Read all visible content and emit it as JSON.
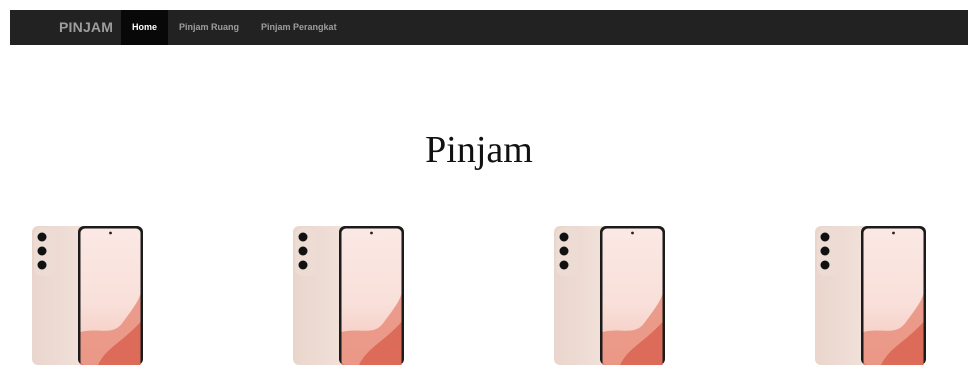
{
  "navbar": {
    "brand": "PINJAM",
    "links": [
      {
        "label": "Home",
        "active": true
      },
      {
        "label": "Pinjam Ruang",
        "active": false
      },
      {
        "label": "Pinjam Perangkat",
        "active": false
      }
    ]
  },
  "main": {
    "title": "Pinjam",
    "products": [
      {
        "image": "phone-image"
      },
      {
        "image": "phone-image"
      },
      {
        "image": "phone-image"
      },
      {
        "image": "phone-image"
      }
    ]
  },
  "colors": {
    "navbar_bg": "#222222",
    "active_bg": "#080808",
    "nav_text": "#9d9d9d"
  }
}
